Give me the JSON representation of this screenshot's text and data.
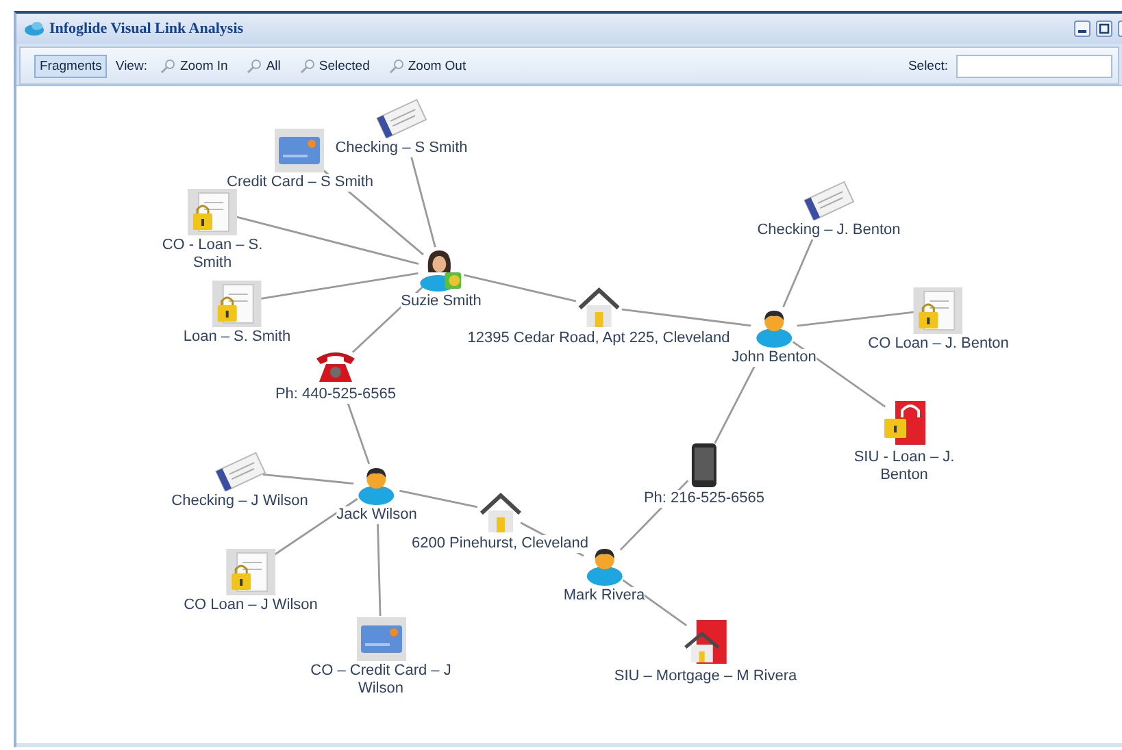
{
  "window": {
    "title": "Infoglide Visual Link Analysis"
  },
  "toolbar": {
    "fragments": {
      "label": "Fragments",
      "selected": true
    },
    "view_label": "View:",
    "view_buttons": [
      "Zoom In",
      "All",
      "Selected",
      "Zoom Out"
    ],
    "select_label": "Select:"
  },
  "nodes": [
    {
      "label": "Checking – S Smith",
      "kind": "cheque"
    },
    {
      "label": "Credit Card – S Smith",
      "kind": "card"
    },
    {
      "label": "Checking – J. Benton",
      "kind": "cheque"
    },
    {
      "label": "CO - Loan – S. Smith",
      "kind": "doc_lock"
    },
    {
      "label": "Suzie Smith",
      "kind": "woman"
    },
    {
      "label": "Loan – S. Smith",
      "kind": "doc_lock"
    },
    {
      "label": "12395 Cedar Road, Apt 225, Cleveland",
      "kind": "house"
    },
    {
      "label": "CO Loan – J. Benton",
      "kind": "doc_lock"
    },
    {
      "label": "John Benton",
      "kind": "person"
    },
    {
      "label": "Ph: 440-525-6565",
      "kind": "telephone"
    },
    {
      "label": "SIU - Loan – J. Benton",
      "kind": "siu_lock"
    },
    {
      "label": "Checking – J Wilson",
      "kind": "cheque"
    },
    {
      "label": "Ph: 216-525-6565",
      "kind": "mobile"
    },
    {
      "label": "Jack Wilson",
      "kind": "person"
    },
    {
      "label": "6200 Pinehurst, Cleveland",
      "kind": "house"
    },
    {
      "label": "Mark Rivera",
      "kind": "person"
    },
    {
      "label": "CO Loan – J Wilson",
      "kind": "doc_lock"
    },
    {
      "label": "CO – Credit Card – J Wilson",
      "kind": "card"
    },
    {
      "label": "SIU – Mortgage – M Rivera",
      "kind": "siu_house"
    }
  ]
}
